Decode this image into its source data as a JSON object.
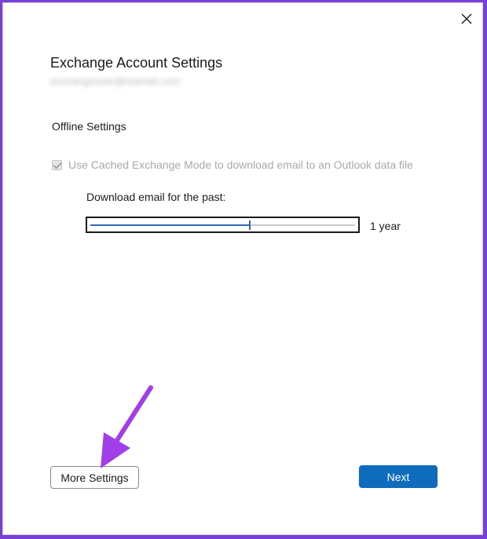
{
  "dialog": {
    "title": "Exchange Account Settings",
    "email": "exchangeuser@hotmail.com",
    "close_icon": "close-icon"
  },
  "offline": {
    "section_label": "Offline Settings",
    "cached_mode_label": "Use Cached Exchange Mode to download email to an Outlook data file",
    "cached_mode_checked": true,
    "cached_mode_enabled": false,
    "download_label": "Download email for the past:",
    "slider_fraction": 0.6,
    "slider_value": "1 year"
  },
  "buttons": {
    "more_settings": "More Settings",
    "next": "Next"
  },
  "colors": {
    "accent": "#0f6cbd",
    "slider": "#2f6bb5",
    "annotation_arrow": "#a23ee8",
    "frame": "#7a3fd6"
  },
  "annotation": {
    "icon": "pointer-arrow-icon"
  }
}
